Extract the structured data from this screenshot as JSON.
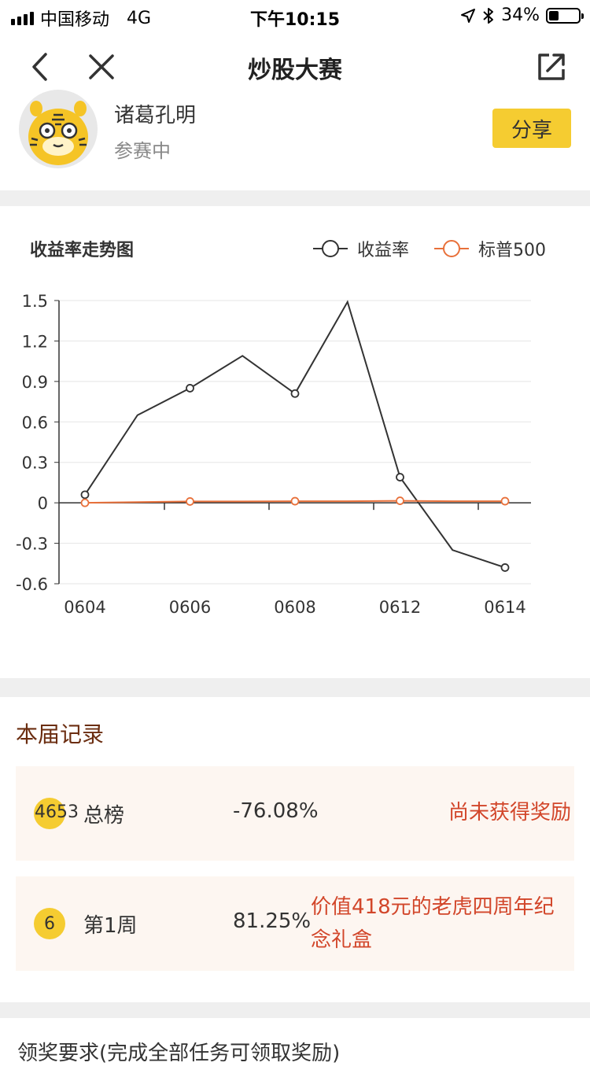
{
  "status_bar": {
    "carrier": "中国移动",
    "network": "4G",
    "time": "下午10:15",
    "battery": "34%",
    "battery_level": 0.34,
    "icons": [
      "signal-icon",
      "location-arrow-icon",
      "bluetooth-icon",
      "battery-icon"
    ]
  },
  "nav": {
    "title": "炒股大赛",
    "back_icon": "chevron-left-icon",
    "close_icon": "close-icon",
    "external_icon": "external-link-icon"
  },
  "profile": {
    "name": "诸葛孔明",
    "status": "参赛中",
    "share_label": "分享",
    "avatar_icon": "tiger-avatar-icon"
  },
  "chart": {
    "title": "收益率走势图",
    "legend": [
      "收益率",
      "标普500"
    ],
    "colors": {
      "series1": "#333333",
      "series2": "#e8703a",
      "grid": "#e5e5e5",
      "axis": "#333333"
    },
    "y_ticks": [
      "1.5",
      "1.2",
      "0.9",
      "0.6",
      "0.3",
      "0",
      "-0.3",
      "-0.6"
    ],
    "x_tick_labels": [
      "0604",
      "0606",
      "0608",
      "0612",
      "0614"
    ]
  },
  "chart_data": {
    "type": "line",
    "title": "收益率走势图",
    "x": [
      "0604",
      "0605",
      "0606",
      "0607",
      "0608",
      "0609",
      "0612",
      "0613",
      "0614"
    ],
    "series": [
      {
        "name": "收益率",
        "values": [
          0.06,
          0.65,
          0.85,
          1.09,
          0.81,
          1.49,
          0.19,
          -0.35,
          -0.48
        ],
        "markers_at": [
          0,
          2,
          4,
          6,
          8
        ]
      },
      {
        "name": "标普500",
        "values": [
          0.0,
          0.005,
          0.01,
          0.01,
          0.012,
          0.012,
          0.015,
          0.012,
          0.012
        ],
        "markers_at": [
          0,
          2,
          4,
          6,
          8
        ]
      }
    ],
    "ylim": [
      -0.6,
      1.5
    ],
    "y_ticks": [
      1.5,
      1.2,
      0.9,
      0.6,
      0.3,
      0,
      -0.3,
      -0.6
    ],
    "x_labels_shown": [
      "0604",
      "0606",
      "0608",
      "0612",
      "0614"
    ],
    "grid": true,
    "legend_position": "top-right"
  },
  "records": {
    "title": "本届记录",
    "items": [
      {
        "rank": "4653",
        "name": "总榜",
        "rate": "-76.08%",
        "reward": "尚未获得奖励"
      },
      {
        "rank": "6",
        "name": "第1周",
        "rate": "81.25%",
        "reward": "价值418元的老虎四周年纪念礼盒"
      }
    ]
  },
  "footer": {
    "text": "领奖要求(完成全部任务可领取奖励)"
  }
}
